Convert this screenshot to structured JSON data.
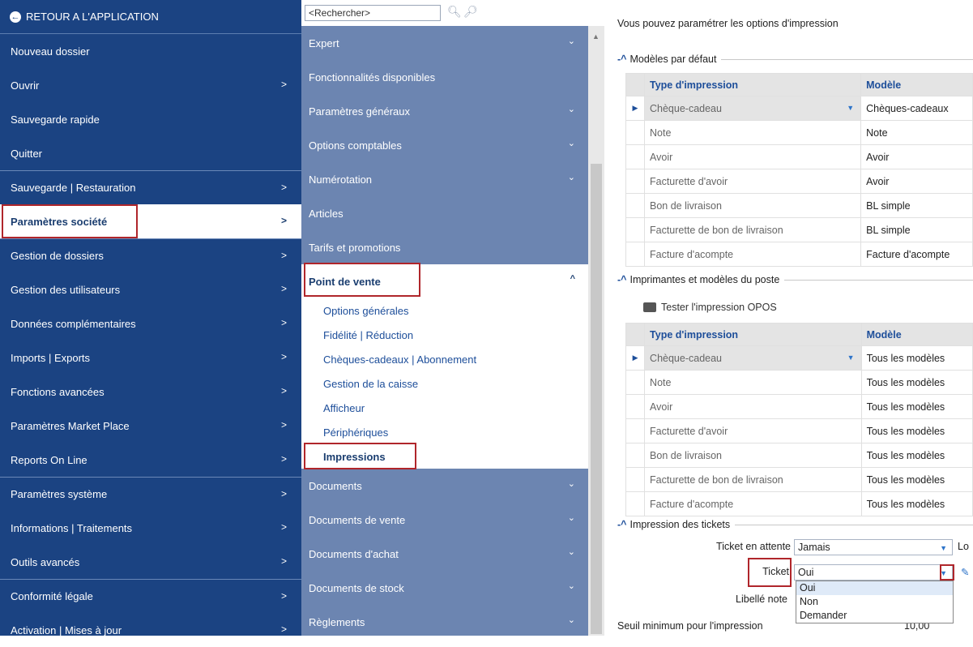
{
  "left": {
    "back_label": "RETOUR A L'APPLICATION",
    "items": [
      {
        "label": "Nouveau dossier",
        "chev": ""
      },
      {
        "label": "Ouvrir",
        "chev": ">"
      },
      {
        "label": "Sauvegarde rapide",
        "chev": ""
      },
      {
        "label": "Quitter",
        "chev": ""
      },
      {
        "label": "Sauvegarde | Restauration",
        "chev": ">"
      },
      {
        "label": "Paramètres société",
        "chev": ">"
      },
      {
        "label": "Gestion de dossiers",
        "chev": ">"
      },
      {
        "label": "Gestion des utilisateurs",
        "chev": ">"
      },
      {
        "label": "Données complémentaires",
        "chev": ">"
      },
      {
        "label": "Imports | Exports",
        "chev": ">"
      },
      {
        "label": "Fonctions avancées",
        "chev": ">"
      },
      {
        "label": "Paramètres Market Place",
        "chev": ">"
      },
      {
        "label": "Reports On Line",
        "chev": ">"
      },
      {
        "label": "Paramètres système",
        "chev": ">"
      },
      {
        "label": "Informations | Traitements",
        "chev": ">"
      },
      {
        "label": "Outils avancés",
        "chev": ">"
      },
      {
        "label": "Conformité légale",
        "chev": ">"
      },
      {
        "label": "Activation | Mises à jour",
        "chev": ">"
      }
    ]
  },
  "mid": {
    "search_placeholder": "<Rechercher>",
    "items_top": [
      {
        "label": "Expert",
        "chev": "⌄"
      },
      {
        "label": "Fonctionnalités disponibles",
        "chev": ""
      },
      {
        "label": "Paramètres généraux",
        "chev": "⌄"
      },
      {
        "label": "Options comptables",
        "chev": "⌄"
      },
      {
        "label": "Numérotation",
        "chev": "⌄"
      },
      {
        "label": "Articles",
        "chev": ""
      },
      {
        "label": "Tarifs et promotions",
        "chev": ""
      }
    ],
    "expanded": {
      "label": "Point de vente",
      "chev": "^",
      "subs": [
        "Options générales",
        "Fidélité | Réduction",
        "Chèques-cadeaux | Abonnement",
        "Gestion de la caisse",
        "Afficheur",
        "Périphériques",
        "Impressions"
      ]
    },
    "items_bottom": [
      {
        "label": "Documents",
        "chev": "⌄"
      },
      {
        "label": "Documents de vente",
        "chev": "⌄"
      },
      {
        "label": "Documents d'achat",
        "chev": "⌄"
      },
      {
        "label": "Documents de stock",
        "chev": "⌄"
      },
      {
        "label": "Règlements",
        "chev": "⌄"
      }
    ]
  },
  "right": {
    "intro": "Vous pouvez paramétrer les options d'impression",
    "group1": "Modèles par défaut",
    "group2": "Imprimantes et modèles du poste",
    "group3": "Impression des tickets",
    "col_type": "Type d'impression",
    "col_model": "Modèle",
    "table1": [
      {
        "type": "Chèque-cadeau",
        "model": "Chèques-cadeaux"
      },
      {
        "type": "Note",
        "model": "Note"
      },
      {
        "type": "Avoir",
        "model": "Avoir"
      },
      {
        "type": "Facturette d'avoir",
        "model": "Avoir"
      },
      {
        "type": "Bon de livraison",
        "model": "BL simple"
      },
      {
        "type": "Facturette de bon de livraison",
        "model": "BL simple"
      },
      {
        "type": "Facture d'acompte",
        "model": "Facture d'acompte"
      }
    ],
    "test_button": "Tester l'impression OPOS",
    "table2": [
      {
        "type": "Chèque-cadeau",
        "model": "Tous les modèles"
      },
      {
        "type": "Note",
        "model": "Tous les modèles"
      },
      {
        "type": "Avoir",
        "model": "Tous les modèles"
      },
      {
        "type": "Facturette d'avoir",
        "model": "Tous les modèles"
      },
      {
        "type": "Bon de livraison",
        "model": "Tous les modèles"
      },
      {
        "type": "Facturette de bon de livraison",
        "model": "Tous les modèles"
      },
      {
        "type": "Facture d'acompte",
        "model": "Tous les modèles"
      }
    ],
    "ticket_attente_label": "Ticket en attente",
    "ticket_attente_value": "Jamais",
    "lo_text": "Lo",
    "ticket_label": "Ticket",
    "ticket_value": "Oui",
    "libelle_label": "Libellé note",
    "seuil_label": "Seuil minimum pour l'impression",
    "seuil_value": "10,00",
    "dropdown_options": [
      "Oui",
      "Non",
      "Demander"
    ]
  },
  "colors": {
    "sidebar": "#1b4382",
    "midpanel": "#6c85b1",
    "highlight": "#b0262b"
  }
}
